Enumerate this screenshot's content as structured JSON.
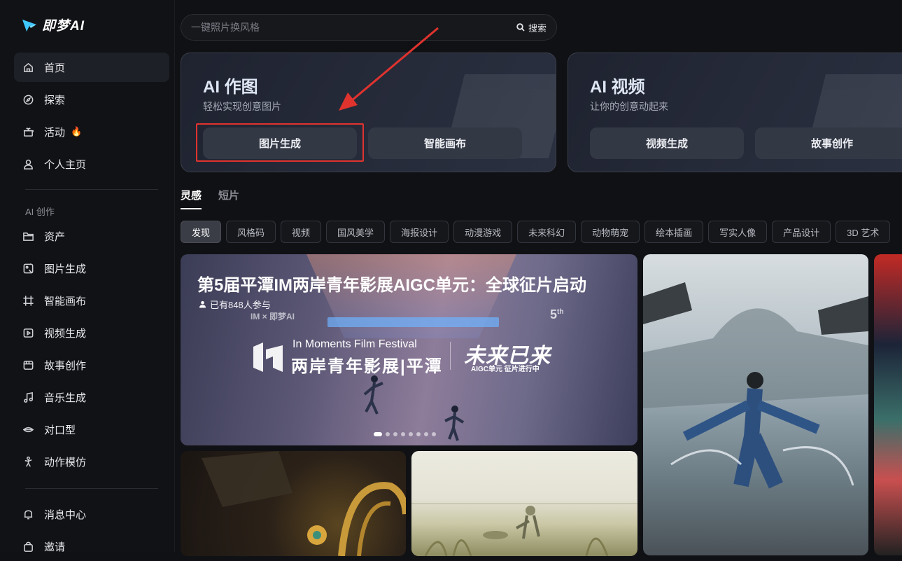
{
  "app": {
    "logo_text": "即梦AI"
  },
  "sidebar": {
    "items": [
      {
        "label": "首页",
        "icon": "home-icon"
      },
      {
        "label": "探索",
        "icon": "compass-icon"
      },
      {
        "label": "活动",
        "icon": "gift-icon",
        "badge": "🔥"
      },
      {
        "label": "个人主页",
        "icon": "user-icon"
      }
    ],
    "section_label": "AI 创作",
    "tools": [
      {
        "label": "资产",
        "icon": "folder-icon"
      },
      {
        "label": "图片生成",
        "icon": "image-gen-icon"
      },
      {
        "label": "智能画布",
        "icon": "canvas-icon"
      },
      {
        "label": "视频生成",
        "icon": "video-gen-icon"
      },
      {
        "label": "故事创作",
        "icon": "story-icon"
      },
      {
        "label": "音乐生成",
        "icon": "music-icon"
      },
      {
        "label": "对口型",
        "icon": "lip-sync-icon"
      },
      {
        "label": "动作模仿",
        "icon": "motion-icon"
      }
    ],
    "bottom": [
      {
        "label": "消息中心",
        "icon": "bell-icon"
      },
      {
        "label": "邀请",
        "icon": "invite-icon"
      }
    ]
  },
  "search": {
    "placeholder": "一键照片换风格",
    "button_label": "搜索"
  },
  "cards": {
    "image": {
      "title": "AI 作图",
      "subtitle": "轻松实现创意图片",
      "btn1": "图片生成",
      "btn2": "智能画布"
    },
    "video": {
      "title": "AI 视频",
      "subtitle": "让你的创意动起来",
      "btn1": "视频生成",
      "btn2": "故事创作"
    }
  },
  "tabs": [
    "灵感",
    "短片"
  ],
  "chips": [
    "发现",
    "风格码",
    "视频",
    "国风美学",
    "海报设计",
    "动漫游戏",
    "未来科幻",
    "动物萌宠",
    "绘本插画",
    "写实人像",
    "产品设计",
    "3D 艺术"
  ],
  "banner": {
    "title": "第5届平潭IM两岸青年影展AIGC单元：全球征片启动",
    "participants": "已有848人参与",
    "small_logo": "IM × 即梦AI",
    "edition": "5",
    "edition_suffix": "th",
    "festival_en": "In Moments Film Festival",
    "festival_cn": "两岸青年影展|平潭",
    "slogan": "未来已来",
    "aigc_line": "AIGC单元 征片进行中",
    "slides_total": 8,
    "slide_active": 1
  },
  "colors": {
    "accent_red": "#e0332e",
    "active_chip": "#3a3d46",
    "background": "#101114"
  }
}
